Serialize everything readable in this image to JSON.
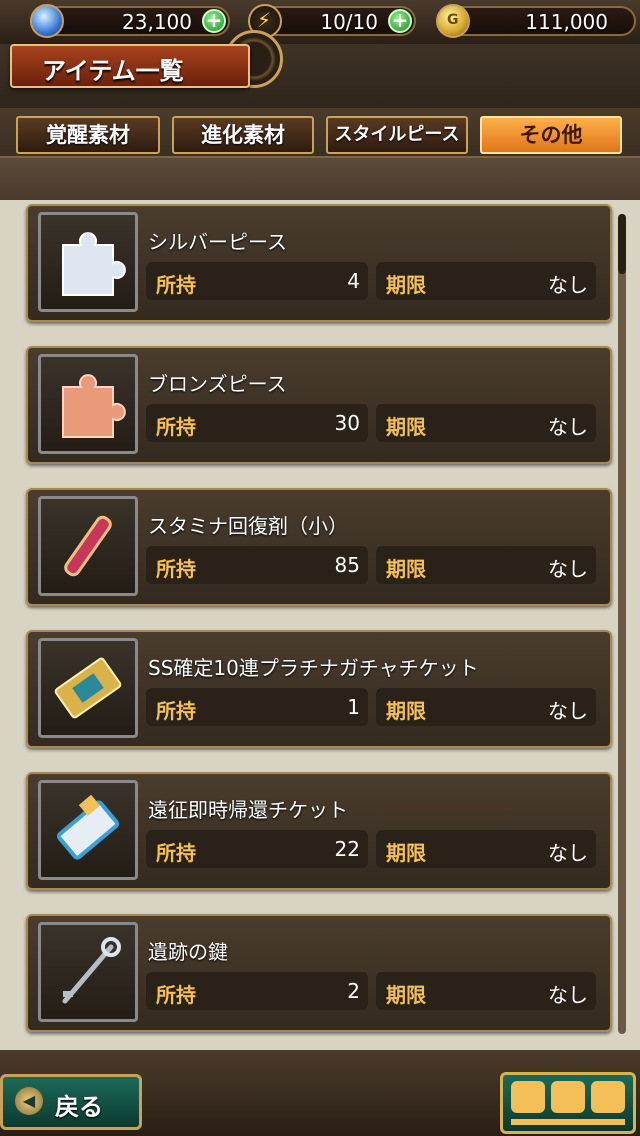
{
  "status": {
    "gems": "23,100",
    "stamina": "10/10",
    "gold": "111,000"
  },
  "header": {
    "title": "アイテム一覧"
  },
  "tabs": [
    {
      "label": "覚醒素材",
      "active": false
    },
    {
      "label": "進化素材",
      "active": false
    },
    {
      "label": "スタイルピース",
      "active": false
    },
    {
      "label": "その他",
      "active": true
    }
  ],
  "labels": {
    "owned": "所持",
    "expiry": "期限"
  },
  "items": [
    {
      "name": "シルバーピース",
      "owned": "4",
      "expiry": "なし",
      "icon": "silver-piece-icon"
    },
    {
      "name": "ブロンズピース",
      "owned": "30",
      "expiry": "なし",
      "icon": "bronze-piece-icon"
    },
    {
      "name": "スタミナ回復剤（小）",
      "owned": "85",
      "expiry": "なし",
      "icon": "stamina-potion-icon"
    },
    {
      "name": "SS確定10連プラチナガチャチケット",
      "owned": "1",
      "expiry": "なし",
      "icon": "gacha-ticket-icon"
    },
    {
      "name": "遠征即時帰還チケット",
      "owned": "22",
      "expiry": "なし",
      "icon": "return-ticket-icon"
    },
    {
      "name": "遺跡の鍵",
      "owned": "2",
      "expiry": "なし",
      "icon": "key-icon"
    }
  ],
  "footer": {
    "back_label": "戻る"
  },
  "colors": {
    "accent": "#f2c056",
    "active_tab": "#ffb04a",
    "card_border": "#a78a52"
  }
}
